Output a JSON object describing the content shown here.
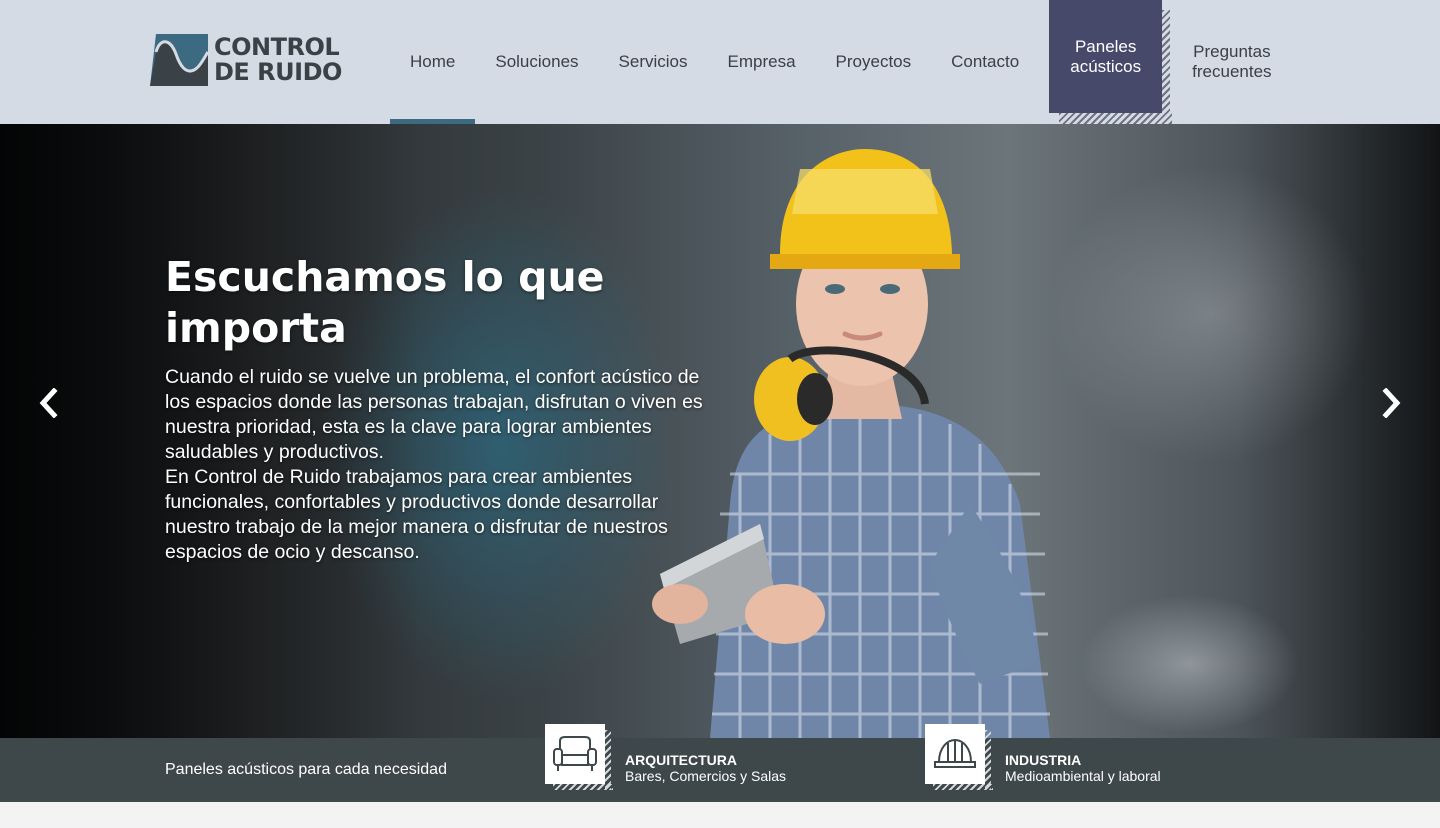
{
  "brand": {
    "line1": "CONTROL",
    "line2": "DE RUIDO"
  },
  "nav": {
    "items": [
      {
        "label": "Home"
      },
      {
        "label": "Soluciones"
      },
      {
        "label": "Servicios"
      },
      {
        "label": "Empresa"
      },
      {
        "label": "Proyectos"
      },
      {
        "label": "Contacto"
      }
    ],
    "special": {
      "line1": "Paneles",
      "line2": "acústicos"
    },
    "faq": {
      "line1": "Preguntas",
      "line2": "frecuentes"
    },
    "active": "Home"
  },
  "hero": {
    "title": "Escuchamos lo que importa",
    "paragraph1": "Cuando el ruido se vuelve un problema, el confort acústico de los espacios donde las personas trabajan, disfrutan o viven es nuestra prioridad, esta es la clave para lograr ambientes saludables y productivos.",
    "paragraph2": "En Control de Ruido trabajamos para crear ambientes funcionales, confortables y productivos donde desarrollar nuestro trabajo de la mejor manera o disfrutar de nuestros espacios de ocio y descanso.",
    "prev_icon": "chevron-left-icon",
    "next_icon": "chevron-right-icon"
  },
  "band": {
    "label": "Paneles acústicos para cada necesidad",
    "categories": [
      {
        "title": "ARQUITECTURA",
        "subtitle": "Bares, Comercios y Salas",
        "icon": "armchair-icon"
      },
      {
        "title": "INDUSTRIA",
        "subtitle": "Medioambiental y laboral",
        "icon": "hard-hat-icon"
      }
    ]
  },
  "colors": {
    "header_bg": "#d5dbe4",
    "nav_special_bg": "#46496a",
    "active_underline": "#3c6a80",
    "band_bg": "#3e4749",
    "logo_dark": "#3a4247",
    "logo_accent": "#3c6a80"
  }
}
